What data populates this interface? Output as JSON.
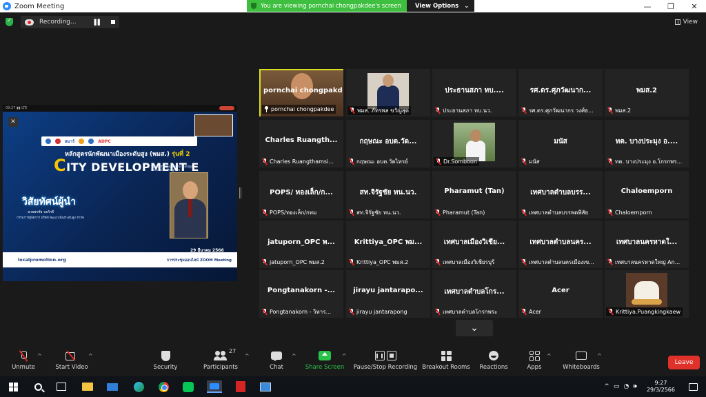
{
  "window": {
    "title": "Zoom Meeting",
    "controls": [
      "—",
      "❐",
      "✕"
    ]
  },
  "share_banner": {
    "message": "You are viewing pornchai chongpakdee's screen",
    "view_options": "View Options",
    "caret": "⌄"
  },
  "topbar": {
    "recording_label": "Recording...",
    "view_label": "View"
  },
  "shared_screen": {
    "phone_status": "09:27 ▮▮ LTE",
    "close": "✕",
    "logos": [
      "สมาร์",
      "ADPC"
    ],
    "course_prefix": "หลักสูตรนักพัฒนาเมืองระดับสูง (พมส.)",
    "course_gen": "รุ่นที่ 2",
    "city_c": "C",
    "city_rest": "ITY DEVELOPMENT E",
    "exec_note": "หลักสูตรนักพัฒนาเมืองระดับสูง Executive Program",
    "vision": "วิสัยทัศน์ผู้นำ",
    "speaker_name": "นายพรชัย จงภักดี",
    "speaker_role": "กรรมการผู้จัดการ บริษัท พัฒนาเมืองระดับสูง จำกัด",
    "date": "29 มีนาคม 2566",
    "site": "localpromotion.org",
    "online_note": "การประชุมออนไลน์ ZOOM Meeting"
  },
  "participants": [
    {
      "name": "pornchai chongpakdee",
      "label": "pornchai chongpakdee",
      "video": "man",
      "active": true,
      "pinned": true
    },
    {
      "name": "",
      "label": "พมส. ภัทรพล ขวัญสุด",
      "video": "suit"
    },
    {
      "name": "ประธานสภา ทบ....",
      "label": "ประธานสภา ทบ.นว."
    },
    {
      "name": "รศ.ดร.ศุภวัฒนาก...",
      "label": "รศ.ดร.ศุภวัฒนากร วงศ์ธ..."
    },
    {
      "name": "พมส.2",
      "label": "พมส.2"
    },
    {
      "name": "Charles Ruangth...",
      "label": "Charles Ruangthamsi..."
    },
    {
      "name": "กฤษณะ อบต.วัด...",
      "label": "กฤษณะ อบต.วัดไทรย์"
    },
    {
      "name": "",
      "label": "Dr.Somboon",
      "video": "outdoor"
    },
    {
      "name": "มนัส",
      "label": "มนัส"
    },
    {
      "name": "ทต. บางประมุง อ....",
      "label": "ทต. บางประมุง อ.โกรกพร..."
    },
    {
      "name": "POPS/ ทองเล็ก/ก...",
      "label": "POPS/ทองเล็ก/กทม"
    },
    {
      "name": "สท.จิรัฐชัย ทน.นว.",
      "label": "สท.จิรัฐชัย ทน.นว."
    },
    {
      "name": "Pharamut (Tan)",
      "label": "Pharamut (Tan)"
    },
    {
      "name": "เทศบาลตำบลบรร...",
      "label": "เทศบาลตำบลบรรพตพิสัย"
    },
    {
      "name": "Chaloemporn",
      "label": "Chaloemporn"
    },
    {
      "name": "jatuporn_OPC พ...",
      "label": "jatuporn_OPC พมส.2"
    },
    {
      "name": "Krittiya_OPC พม...",
      "label": "Krittiya_OPC พมส.2"
    },
    {
      "name": "เทศบาลเมืองวิเชีย...",
      "label": "เทศบาลเมืองวิเชียรบุรี"
    },
    {
      "name": "เทศบาลตำบลนคร...",
      "label": "เทศบาลตำบลนครเมืองเข..."
    },
    {
      "name": "เทศบาลนครหาดใ...",
      "label": "เทศบาลนครหาดใหญ่ An..."
    },
    {
      "name": "Pongtanakorn -...",
      "label": "Pongtanakorn - วิหาร..."
    },
    {
      "name": "jirayu jantarapo...",
      "label": "jirayu jantarapong"
    },
    {
      "name": "เทศบาลตำบลโกร...",
      "label": "เทศบาลตำบลโกรกพระ"
    },
    {
      "name": "Acer",
      "label": "Acer"
    },
    {
      "name": "",
      "label": "Krittiya.Puangkingkaew",
      "video": "food"
    }
  ],
  "gallery_next": "⌄",
  "toolbar": {
    "unmute": "Unmute",
    "start_video": "Start Video",
    "security": "Security",
    "participants": "Participants",
    "participant_count": "27",
    "chat": "Chat",
    "share_screen": "Share Screen",
    "recording": "Pause/Stop Recording",
    "breakout": "Breakout Rooms",
    "reactions": "Reactions",
    "apps": "Apps",
    "whiteboards": "Whiteboards",
    "leave": "Leave",
    "caret": "^"
  },
  "taskbar": {
    "time": "9:27",
    "date": "29/3/2566",
    "tray_symbols": [
      "^",
      "▭",
      "◔",
      "🕪"
    ]
  },
  "colors": {
    "banner_green": "#3fbf3f",
    "active_speaker": "#d9e021",
    "share_green": "#2bc24a",
    "leave_red": "#e0312a"
  }
}
